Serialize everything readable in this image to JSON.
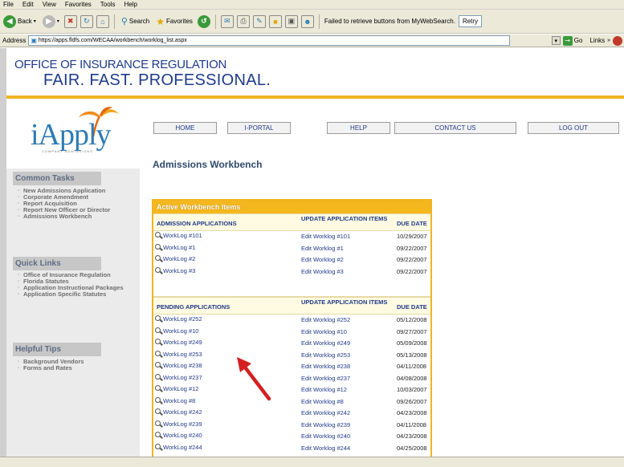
{
  "browser": {
    "menu": [
      "File",
      "Edit",
      "View",
      "Favorites",
      "Tools",
      "Help"
    ],
    "toolbar": {
      "back_label": "Back",
      "search_label": "Search",
      "favorites_label": "Favorites",
      "status_message": "Failed to retrieve buttons from MyWebSearch.",
      "retry_label": "Retry"
    },
    "address": {
      "label": "Address",
      "url": "https://apps.fldfs.com/WECAA/workbench/worklog_list.aspx",
      "go_label": "Go",
      "links_label": "Links"
    }
  },
  "header": {
    "org_name": "OFFICE OF INSURANCE REGULATION",
    "slogan": "FAIR. FAST. PROFESSIONAL.",
    "accent_color": "#f0b323"
  },
  "logo": {
    "text": "iApply",
    "subtext": "COMPANY ADMISSIONS"
  },
  "nav": [
    "HOME",
    "I-PORTAL",
    "HELP",
    "CONTACT US",
    "LOG OUT"
  ],
  "sidebar": {
    "common_tasks": {
      "title": "Common Tasks",
      "items": [
        "New Admissions Application",
        "Corporate Amendment",
        "Report Acquisition",
        "Report New Officer or Director",
        "Admissions Workbench"
      ]
    },
    "quick_links": {
      "title": "Quick Links",
      "items": [
        "Office of Insurance Regulation",
        "Florida Statutes",
        "Application Instructional Packages",
        "Application Specific Statutes"
      ]
    },
    "helpful_tips": {
      "title": "Helpful Tips",
      "items": [
        "Background Vendors",
        "Forms and Rates"
      ]
    }
  },
  "main": {
    "title": "Admissions Workbench",
    "table_title": "Active Workbench Items",
    "admission": {
      "headers": [
        "ADMISSION APPLICATIONS",
        "UPDATE APPLICATION ITEMS",
        "DUE DATE"
      ],
      "rows": [
        {
          "worklog": "WorkLog #101",
          "edit": "Edit Worklog #101",
          "due": "10/29/2007"
        },
        {
          "worklog": "WorkLog #1",
          "edit": "Edit Worklog #1",
          "due": "09/22/2007"
        },
        {
          "worklog": "WorkLog #2",
          "edit": "Edit Worklog #2",
          "due": "09/22/2007"
        },
        {
          "worklog": "WorkLog #3",
          "edit": "Edit Worklog #3",
          "due": "09/22/2007"
        }
      ]
    },
    "pending": {
      "headers": [
        "PENDING APPLICATIONS",
        "UPDATE APPLICATION ITEMS",
        "DUE DATE"
      ],
      "rows": [
        {
          "worklog": "WorkLog #252",
          "edit": "Edit Worklog #252",
          "due": "05/12/2008"
        },
        {
          "worklog": "WorkLog #10",
          "edit": "Edit Worklog #10",
          "due": "09/27/2007"
        },
        {
          "worklog": "WorkLog #249",
          "edit": "Edit Worklog #249",
          "due": "05/09/2008"
        },
        {
          "worklog": "WorkLog #253",
          "edit": "Edit Worklog #253",
          "due": "05/13/2008"
        },
        {
          "worklog": "WorkLog #238",
          "edit": "Edit Worklog #238",
          "due": "04/11/2008"
        },
        {
          "worklog": "WorkLog #237",
          "edit": "Edit Worklog #237",
          "due": "04/08/2008"
        },
        {
          "worklog": "WorkLog #12",
          "edit": "Edit Worklog #12",
          "due": "10/03/2007"
        },
        {
          "worklog": "WorkLog #8",
          "edit": "Edit Worklog #8",
          "due": "09/26/2007"
        },
        {
          "worklog": "WorkLog #242",
          "edit": "Edit Worklog #242",
          "due": "04/23/2008"
        },
        {
          "worklog": "WorkLog #239",
          "edit": "Edit Worklog #239",
          "due": "04/11/2008"
        },
        {
          "worklog": "WorkLog #240",
          "edit": "Edit Worklog #240",
          "due": "04/23/2008"
        },
        {
          "worklog": "WorkLog #244",
          "edit": "Edit Worklog #244",
          "due": "04/25/2008"
        }
      ]
    }
  }
}
